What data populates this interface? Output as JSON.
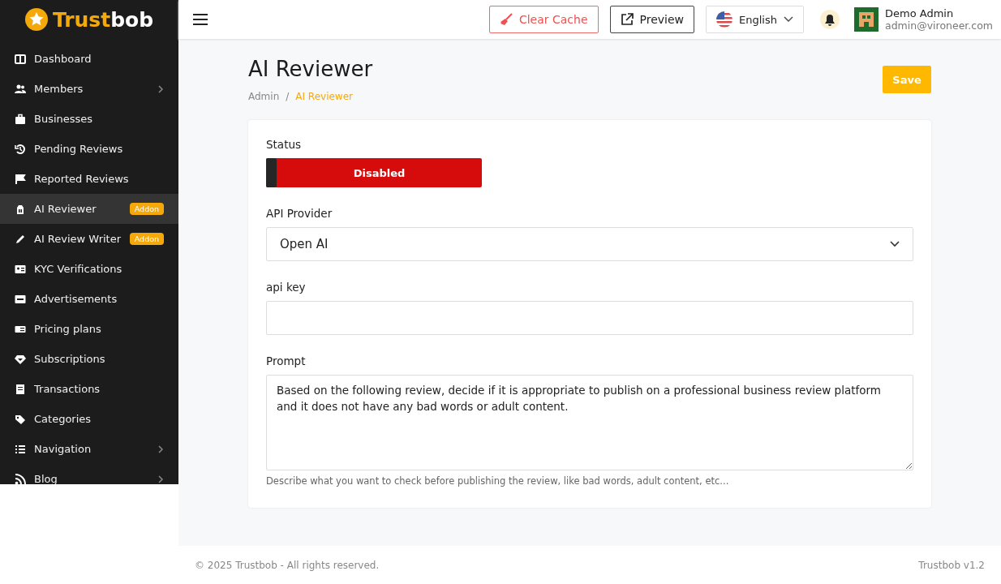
{
  "brand": {
    "name_part_1": "Trust",
    "name_part_2": "bob"
  },
  "sidebar": {
    "items": [
      {
        "label": "Dashboard",
        "selected": false,
        "has_submenu": false
      },
      {
        "label": "Members",
        "selected": false,
        "has_submenu": true
      },
      {
        "label": "Businesses",
        "selected": false,
        "has_submenu": false
      },
      {
        "label": "Pending Reviews",
        "selected": false,
        "has_submenu": false
      },
      {
        "label": "Reported Reviews",
        "selected": false,
        "has_submenu": false
      },
      {
        "label": "AI Reviewer",
        "selected": true,
        "has_submenu": false,
        "badge": "Addon"
      },
      {
        "label": "AI Review Writer",
        "selected": false,
        "has_submenu": false,
        "badge": "Addon"
      },
      {
        "label": "KYC Verifications",
        "selected": false,
        "has_submenu": false
      },
      {
        "label": "Advertisements",
        "selected": false,
        "has_submenu": false
      },
      {
        "label": "Pricing plans",
        "selected": false,
        "has_submenu": false
      },
      {
        "label": "Subscriptions",
        "selected": false,
        "has_submenu": false
      },
      {
        "label": "Transactions",
        "selected": false,
        "has_submenu": false
      },
      {
        "label": "Categories",
        "selected": false,
        "has_submenu": false
      },
      {
        "label": "Navigation",
        "selected": false,
        "has_submenu": true
      },
      {
        "label": "Blog",
        "selected": false,
        "has_submenu": true
      }
    ]
  },
  "header": {
    "clear_cache": "Clear Cache",
    "preview": "Preview",
    "language": "English",
    "user": {
      "name": "Demo Admin",
      "email": "admin@vironeer.com"
    }
  },
  "page": {
    "title": "AI Reviewer",
    "breadcrumb_separator": "/",
    "breadcrumb": [
      {
        "label": "Admin",
        "selected": false
      },
      {
        "label": "AI Reviewer",
        "selected": true
      }
    ],
    "save": "Save"
  },
  "form": {
    "status": {
      "label": "Status",
      "on": false,
      "text": "Disabled"
    },
    "provider": {
      "label": "API Provider",
      "value": "Open AI"
    },
    "api_key": {
      "label": "api key"
    },
    "prompt": {
      "label": "Prompt",
      "value": "Based on the following review, decide if it is appropriate to publish on a professional business review platform and it does not have any bad words or adult content.",
      "help": "Describe what you want to check before publishing the review, like bad words, adult content, etc..."
    }
  },
  "footer": {
    "copyright": "© 2025 Trustbob - All rights reserved.",
    "version": "Trustbob v1.2"
  }
}
